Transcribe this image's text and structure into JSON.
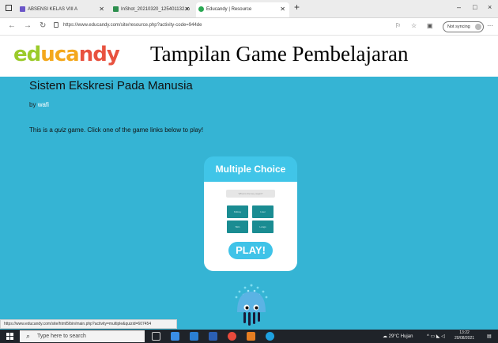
{
  "browser": {
    "tabs": [
      {
        "label": "ABSENSI KELAS VIII A",
        "favicon_color": "#6b56c8"
      },
      {
        "label": "InShot_20210320_125401132.m",
        "favicon_color": "#2d8f4e"
      },
      {
        "label": "Educandy | Resource",
        "favicon_color": "#2aa853"
      }
    ],
    "new_tab": "+",
    "window_controls": [
      "–",
      "□",
      "×"
    ],
    "url": "https://www.educandy.com/site/resource.php?activity-code=944de",
    "sync_label": "Not syncing"
  },
  "header": {
    "logo_letters": [
      {
        "text": "ed",
        "color": "#9bcb2b"
      },
      {
        "text": "uca",
        "color": "#f4a81d"
      },
      {
        "text": "ndy",
        "color": "#e8523f"
      }
    ],
    "slide_title": "Tampilan Game Pembelajaran"
  },
  "main": {
    "background": "#35b4d4",
    "game_title": "Sistem Ekskresi Pada Manusia",
    "by_label": "by",
    "author": "wafi",
    "desc_prefix": "This is a ",
    "desc_emph": "quiz",
    "desc_suffix": " game. Click one of the game links below to play!"
  },
  "card": {
    "title": "Multiple Choice",
    "question": "What is the key organ?",
    "answers": [
      "Kidney",
      "Liver",
      "Skin",
      "Lungs"
    ],
    "play_label": "PLAY!"
  },
  "status_link": "https://www.educandy.com/site/html5/bin/main.php?activity=multiple&quizid=607454",
  "taskbar": {
    "search_placeholder": "Type here to search",
    "weather": "29°C Hujan",
    "time": "13:22",
    "date": "20/08/2021"
  }
}
